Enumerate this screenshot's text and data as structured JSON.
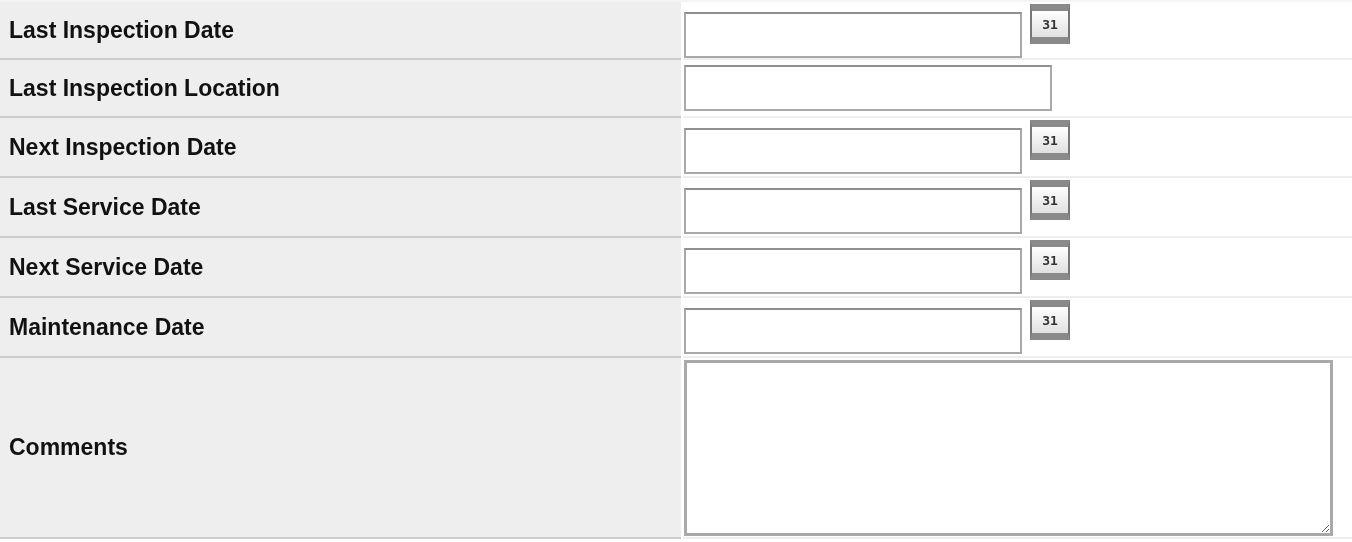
{
  "fields": [
    {
      "label": "Last Inspection Date",
      "kind": "date",
      "button_label": "31"
    },
    {
      "label": "Last Inspection Location",
      "kind": "text"
    },
    {
      "label": "Next Inspection Date",
      "kind": "date",
      "button_label": "31"
    },
    {
      "label": "Last Service Date",
      "kind": "date",
      "button_label": "31"
    },
    {
      "label": "Next Service Date",
      "kind": "date",
      "button_label": "31"
    },
    {
      "label": "Maintenance Date",
      "kind": "date",
      "button_label": "31"
    },
    {
      "label": "Comments",
      "kind": "textarea"
    }
  ]
}
